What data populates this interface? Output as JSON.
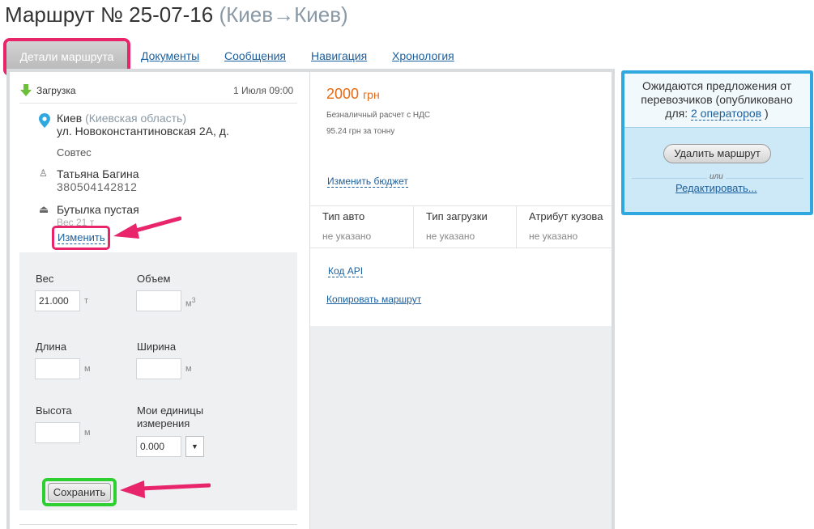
{
  "page": {
    "title_prefix": "Маршрут № 25-07-16",
    "title_route": "(Киев→Киев)"
  },
  "tabs": {
    "active": "Детали маршрута",
    "documents": "Документы",
    "messages": "Сообщения",
    "navigation": "Навигация",
    "chronology": "Хронология"
  },
  "loading": {
    "label": "Загрузка",
    "date": "1 Июля 09:00",
    "city": "Киев",
    "region": "(Киевская область)",
    "address": "ул. Новоконстантиновская 2А, д.",
    "company": "Совтес",
    "contact_name": "Татьяна Багина",
    "contact_phone": "380504142812",
    "cargo": "Бутылка пустая",
    "cargo_weight": "Вес 21 т",
    "change_link": "Изменить"
  },
  "form": {
    "weight_label": "Вес",
    "weight_value": "21.000",
    "weight_unit": "т",
    "volume_label": "Объем",
    "volume_value": "",
    "volume_unit": "м",
    "volume_unit_sup": "3",
    "length_label": "Длина",
    "length_value": "",
    "length_unit": "м",
    "width_label": "Ширина",
    "width_value": "",
    "width_unit": "м",
    "height_label": "Высота",
    "height_value": "",
    "height_unit": "м",
    "custom_label_1": "Мои единицы",
    "custom_label_2": "измерения",
    "custom_value": "0.000",
    "custom_select": "▼",
    "save_label": "Сохранить"
  },
  "budget": {
    "amount": "2000",
    "currency": "грн",
    "payment_note": "Безналичный расчет с НДС",
    "per_ton": "95.24 грн за тонну",
    "change_budget": "Изменить бюджет"
  },
  "attributes": {
    "headers": [
      "Тип авто",
      "Тип загрузки",
      "Атрибут кузова"
    ],
    "values": [
      "не указано",
      "не указано",
      "не указано"
    ]
  },
  "links": {
    "api_code": "Код API",
    "copy_route": "Копировать маршрут"
  },
  "offers": {
    "text_1": "Ожидаются предложения от",
    "text_2": "перевозчиков (опубликовано",
    "text_3": "для:",
    "operators": "2 операторов",
    "text_close": ")",
    "delete_button": "Удалить маршрут",
    "or_text": "или",
    "edit_link": "Редактировать..."
  },
  "colors": {
    "highlight_pink": "#e8256b",
    "highlight_green": "#2ecf31",
    "price_orange": "#e56a14",
    "link_blue": "#1a5f9e",
    "panel_blue": "#2fa8e0"
  }
}
